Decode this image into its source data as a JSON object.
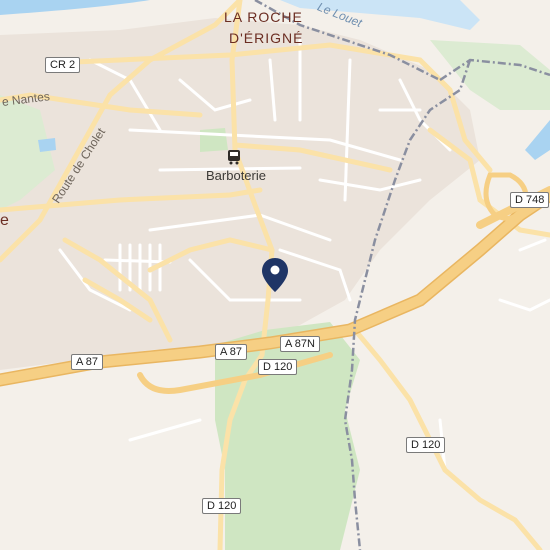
{
  "map": {
    "places": {
      "town_line1": "LA ROCHE",
      "town_line2": "D'ÉRIGNÉ",
      "partial_left": "e"
    },
    "streets": {
      "nantes": "e Nantes",
      "cholet": "Route de Cholet"
    },
    "water": {
      "river": "Le Louet"
    },
    "poi": {
      "bus_stop": "Barboterie"
    },
    "road_shields": {
      "cr2": "CR 2",
      "d748": "D 748",
      "a87_west": "A 87",
      "a87_center": "A 87",
      "a87n": "A 87N",
      "d120_top": "D 120",
      "d120_right": "D 120",
      "d120_bottom": "D 120"
    },
    "colors": {
      "background": "#f4f0ea",
      "urban": "#ebe3db",
      "water": "#a9d3f1",
      "green": "#cfe6c2",
      "motorway": "#f6cf84",
      "major_road": "#fbe2a8",
      "minor_road": "#ffffff",
      "boundary": "#8a8fa0",
      "marker": "#1f3566"
    },
    "icons": {
      "marker": "location-pin-icon",
      "bus": "bus-stop-icon"
    }
  }
}
